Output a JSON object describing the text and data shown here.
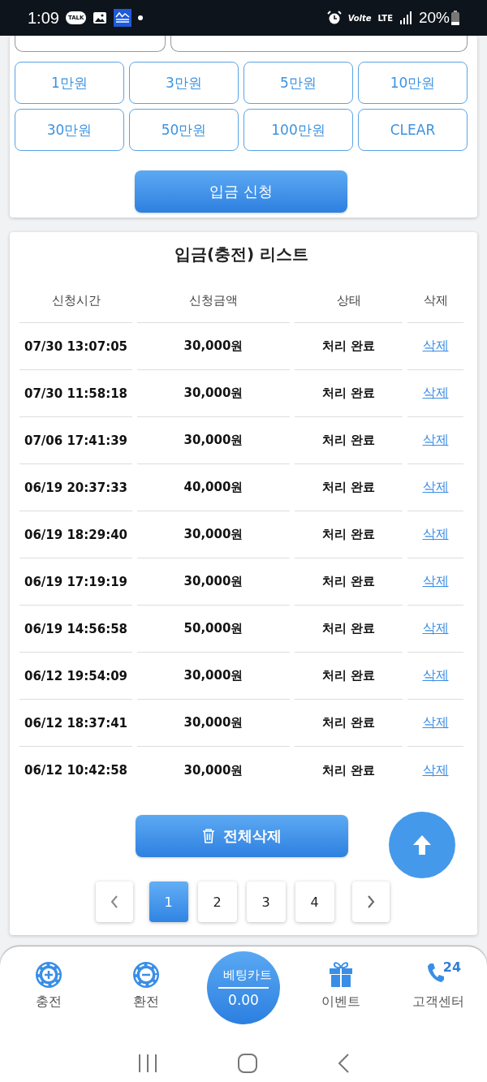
{
  "status_bar": {
    "time": "1:09",
    "chat_badge": "TALK",
    "call_label": "Volte",
    "network_label": "LTE",
    "battery": "20%"
  },
  "deposit_form": {
    "amount_buttons": [
      "1만원",
      "3만원",
      "5만원",
      "10만원",
      "30만원",
      "50만원",
      "100만원",
      "CLEAR"
    ],
    "submit_label": "입금 신청"
  },
  "deposit_list": {
    "title": "입금(충전) 리스트",
    "columns": [
      "신청시간",
      "신청금액",
      "상태",
      "삭제"
    ],
    "rows": [
      {
        "time": "07/30 13:07:05",
        "amount": "30,000원",
        "status": "처리 완료",
        "action": "삭제"
      },
      {
        "time": "07/30 11:58:18",
        "amount": "30,000원",
        "status": "처리 완료",
        "action": "삭제"
      },
      {
        "time": "07/06 17:41:39",
        "amount": "30,000원",
        "status": "처리 완료",
        "action": "삭제"
      },
      {
        "time": "06/19 20:37:33",
        "amount": "40,000원",
        "status": "처리 완료",
        "action": "삭제"
      },
      {
        "time": "06/19 18:29:40",
        "amount": "30,000원",
        "status": "처리 완료",
        "action": "삭제"
      },
      {
        "time": "06/19 17:19:19",
        "amount": "30,000원",
        "status": "처리 완료",
        "action": "삭제"
      },
      {
        "time": "06/19 14:56:58",
        "amount": "50,000원",
        "status": "처리 완료",
        "action": "삭제"
      },
      {
        "time": "06/12 19:54:09",
        "amount": "30,000원",
        "status": "처리 완료",
        "action": "삭제"
      },
      {
        "time": "06/12 18:37:41",
        "amount": "30,000원",
        "status": "처리 완료",
        "action": "삭제"
      },
      {
        "time": "06/12 10:42:58",
        "amount": "30,000원",
        "status": "처리 완료",
        "action": "삭제"
      }
    ],
    "delete_all_label": "전체삭제",
    "pages": [
      {
        "label": "1",
        "selected": true
      },
      {
        "label": "2",
        "selected": false
      },
      {
        "label": "3",
        "selected": false
      },
      {
        "label": "4",
        "selected": false
      }
    ]
  },
  "bottom_nav": {
    "items": [
      {
        "kind": "plus",
        "label": "충전"
      },
      {
        "kind": "minus",
        "label": "환전"
      },
      {
        "kind": "cart",
        "label": "베팅카트",
        "value": "0.00"
      },
      {
        "kind": "gift",
        "label": "이벤트"
      },
      {
        "kind": "phone",
        "label": "고객센터",
        "badge": "24"
      }
    ]
  }
}
